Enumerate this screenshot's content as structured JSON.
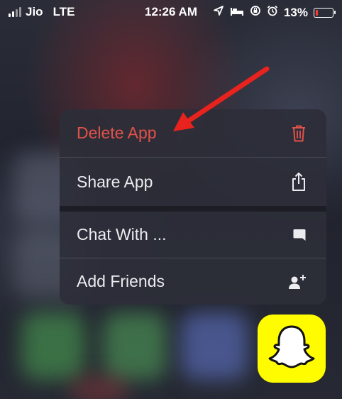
{
  "status_bar": {
    "carrier": "Jio",
    "network": "LTE",
    "time": "12:26 AM",
    "battery_percent": "13%",
    "battery_level": 0.13,
    "battery_color": "#ff3b30"
  },
  "context_menu": {
    "items": [
      {
        "label": "Delete App",
        "icon": "trash-icon",
        "color": "#e0524a"
      },
      {
        "label": "Share App",
        "icon": "share-icon"
      },
      {
        "label": "Chat With ...",
        "icon": "chat-bubble-icon"
      },
      {
        "label": "Add Friends",
        "icon": "add-friend-icon"
      }
    ]
  },
  "annotation": {
    "color": "#e8231d"
  },
  "app_icon": {
    "name": "snapchat-ghost-icon",
    "color": "#fffc00"
  }
}
